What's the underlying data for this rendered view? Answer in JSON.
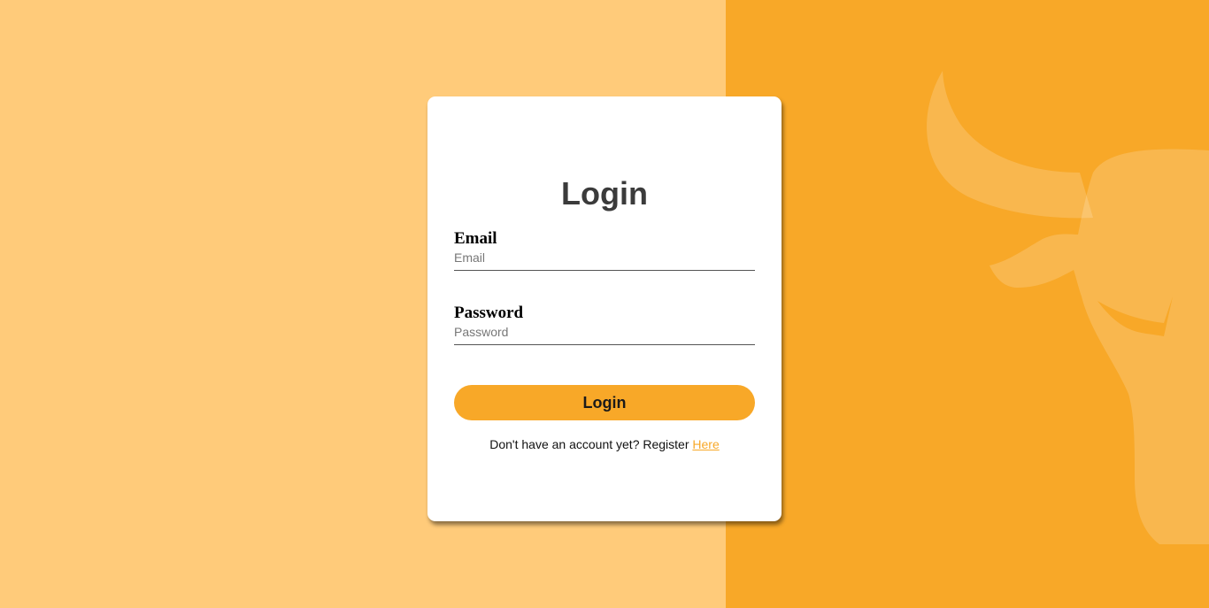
{
  "colors": {
    "left_bg": "#ffcb7a",
    "right_bg": "#f8a828",
    "accent": "#f8a828",
    "card_bg": "#ffffff"
  },
  "background": {
    "decoration_icon": "bull-head-icon"
  },
  "login_card": {
    "title": "Login",
    "email": {
      "label": "Email",
      "placeholder": "Email",
      "value": ""
    },
    "password": {
      "label": "Password",
      "placeholder": "Password",
      "value": ""
    },
    "submit_label": "Login",
    "register_prompt": "Don't have an account yet? Register ",
    "register_link_label": "Here"
  }
}
